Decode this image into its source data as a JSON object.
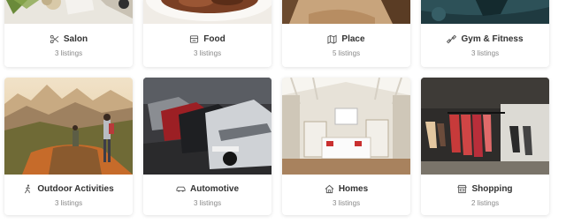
{
  "categories": [
    {
      "title": "Salon",
      "count": "3 listings",
      "icon": "scissors-icon"
    },
    {
      "title": "Food",
      "count": "3 listings",
      "icon": "food-icon"
    },
    {
      "title": "Place",
      "count": "5 listings",
      "icon": "map-icon"
    },
    {
      "title": "Gym & Fitness",
      "count": "3 listings",
      "icon": "dumbbell-icon"
    },
    {
      "title": "Outdoor Activities",
      "count": "3 listings",
      "icon": "hiking-icon"
    },
    {
      "title": "Automotive",
      "count": "3 listings",
      "icon": "car-icon"
    },
    {
      "title": "Homes",
      "count": "3 listings",
      "icon": "home-icon"
    },
    {
      "title": "Shopping",
      "count": "2 listings",
      "icon": "store-icon"
    }
  ]
}
